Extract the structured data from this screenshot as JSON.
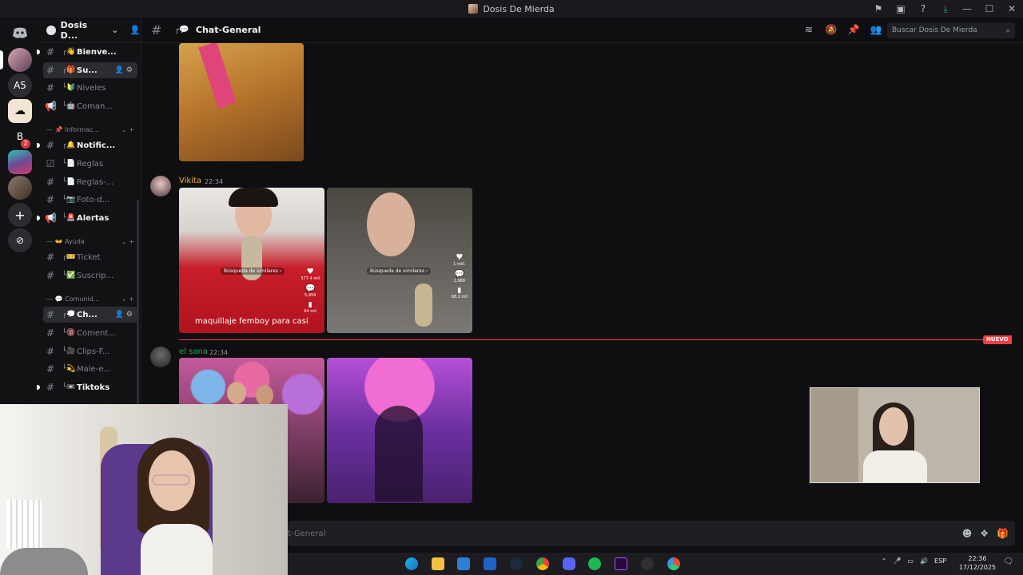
{
  "window": {
    "title": "Dosis De Mierda",
    "controls": [
      "—",
      "☐",
      "✕"
    ]
  },
  "top_icons": [
    "flag-icon",
    "inbox-icon",
    "help-icon",
    "download-icon"
  ],
  "rail": {
    "servers": [
      {
        "label": "",
        "name": "discord-home"
      },
      {
        "label": "",
        "name": "server-1"
      },
      {
        "label": "A5",
        "name": "server-a5"
      },
      {
        "label": "",
        "name": "server-cloud"
      },
      {
        "label": "B",
        "name": "server-b",
        "badge": "2"
      },
      {
        "label": "",
        "name": "server-gradient"
      },
      {
        "label": "",
        "name": "server-photo"
      },
      {
        "label": "+",
        "name": "add-server"
      },
      {
        "label": "⊘",
        "name": "discover"
      }
    ]
  },
  "sidebar": {
    "server_name": "Dosis D...",
    "channels": [
      {
        "label": "Bienve...",
        "emoji": "┌👋",
        "state": "unread",
        "icon": "#"
      },
      {
        "label": "Su...",
        "emoji": "┌🎁",
        "state": "active",
        "icon": "#"
      },
      {
        "label": "Niveles",
        "emoji": "└🔰",
        "state": "read",
        "icon": "#"
      },
      {
        "label": "Coman...",
        "emoji": "└🤖",
        "state": "read",
        "icon": "📢"
      },
      {
        "label": "Notific...",
        "emoji": "┌🔔",
        "state": "unread",
        "icon": "#"
      },
      {
        "label": "Reglas",
        "emoji": "└📄",
        "state": "read",
        "icon": "☑"
      },
      {
        "label": "Reglas-...",
        "emoji": "└📄",
        "state": "read",
        "icon": "#"
      },
      {
        "label": "Foto-d...",
        "emoji": "└📷",
        "state": "read",
        "icon": "#"
      },
      {
        "label": "Alertas",
        "emoji": "└🚨",
        "state": "unread",
        "icon": "📢"
      },
      {
        "label": "Ticket",
        "emoji": "┌🎫",
        "state": "read",
        "icon": "#"
      },
      {
        "label": "Suscrip...",
        "emoji": "└✅",
        "state": "read",
        "icon": "#"
      },
      {
        "label": "Ch...",
        "emoji": "┌💭",
        "state": "active",
        "icon": "#"
      },
      {
        "label": "Coment...",
        "emoji": "└🔞",
        "state": "read",
        "icon": "#"
      },
      {
        "label": "Clips-F...",
        "emoji": "└🎥",
        "state": "read",
        "icon": "#"
      },
      {
        "label": "Male-e...",
        "emoji": "└💫",
        "state": "read",
        "icon": "#"
      },
      {
        "label": "Tiktoks",
        "emoji": "└📼",
        "state": "unread",
        "icon": "#"
      }
    ],
    "categories": [
      {
        "label": "📌 Informac..."
      },
      {
        "label": "👐 Ayuda"
      },
      {
        "label": "💬 Comunid..."
      }
    ]
  },
  "header": {
    "channel": "Chat-General",
    "search_placeholder": "Buscar Dosis De Mierda"
  },
  "messages": [
    {
      "author": "Vikita",
      "time": "22:34",
      "author_color": "#f0b232",
      "caption": "maquillaje femboy para casi",
      "search_chip": "Búsqueda de similares ›",
      "likes1": "577.4 mil",
      "comments1": "5,959",
      "saves1": "64 mil",
      "likes2": "1 mill.",
      "comments2": "2,989",
      "saves2": "68.2 mil"
    },
    {
      "author": "el sana",
      "time": "22:34",
      "author_color": "#23a55a"
    }
  ],
  "new_label": "NUEVO",
  "composer": {
    "placeholder": "t-General"
  },
  "taskbar": {
    "lang": "ESP",
    "time": "22:36",
    "date": "17/12/2025"
  }
}
